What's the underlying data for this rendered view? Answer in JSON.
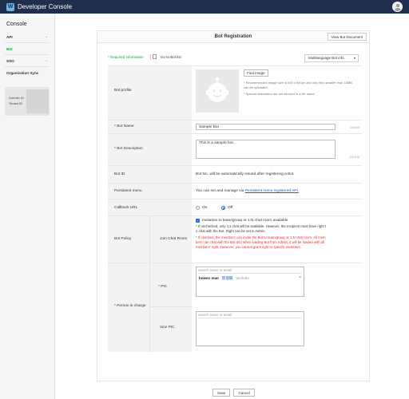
{
  "app": {
    "title": "Developer Console",
    "logo_letter": "W",
    "user_icon": "user-avatar-icon"
  },
  "sidebar": {
    "title": "Console",
    "items": [
      {
        "label": "API",
        "chevron": "⌄"
      },
      {
        "label": "Bot",
        "chevron": ""
      },
      {
        "label": "SSO",
        "chevron": "⌄"
      },
      {
        "label": "Organization Sync",
        "chevron": ""
      }
    ],
    "domain_label": "Domain ID",
    "tenant_label": "Tenant ID"
  },
  "panel": {
    "title": "Bot Registration",
    "view_doc_label": "View Bot Document"
  },
  "toolbar": {
    "required_info": "* Required information",
    "goto_label": "Go to Bot list",
    "multilang_label": "Multilanguage Bot info."
  },
  "form": {
    "profile": {
      "label": "Bot profile",
      "find_image": "Find image",
      "hint1": "* Recommended image size is 640 x 640px and only files smaller than 10MB can be uploaded.",
      "hint2": "* Special characters are not allowed in a file name."
    },
    "name": {
      "label": "* Bot Name",
      "value": "Sample Bot",
      "counter": "10/100"
    },
    "description": {
      "label": "* Bot Description",
      "value": "This is a sample bot.",
      "counter": "21/100"
    },
    "bot_id": {
      "label": "Bot ID",
      "text": "Bot No. will be automatically issued after registering a Bot."
    },
    "menu": {
      "label": "Persistent menu",
      "text": "You can set and manage via ",
      "link": "Persistent menu registered API."
    },
    "callback": {
      "label": "Callback URL",
      "on": "On",
      "off": "Off"
    },
    "policy": {
      "label": "Bot Policy",
      "sub_label": "Join Chat Room",
      "check_label": "Invitation to team/group or 1:N chat room available",
      "note1": "* If unchecked, only 1:1 chat will be available. However, the recipient must have right t",
      "note1b": "o chat with the Bot. Right can be set in Admin.",
      "note2": "* If checked, the members can invite the Bot to team/group or 1:N chat room. All mem",
      "note2b": "bers can chat with the Bot and when loading Bot from Admin, it will be loaded with all",
      "note2c": "members' right. However, you cannot grant right to specific members."
    },
    "person": {
      "label": "* Person in charge",
      "pic_label": "* PIC",
      "vice_label": "Vice PIC",
      "search_placeholder": "Search name or email",
      "pic_name": "bowen mao",
      "pic_role": "管理職",
      "pic_company": "Workato",
      "remove": "×"
    }
  },
  "footer": {
    "save": "Save",
    "cancel": "Cancel"
  }
}
